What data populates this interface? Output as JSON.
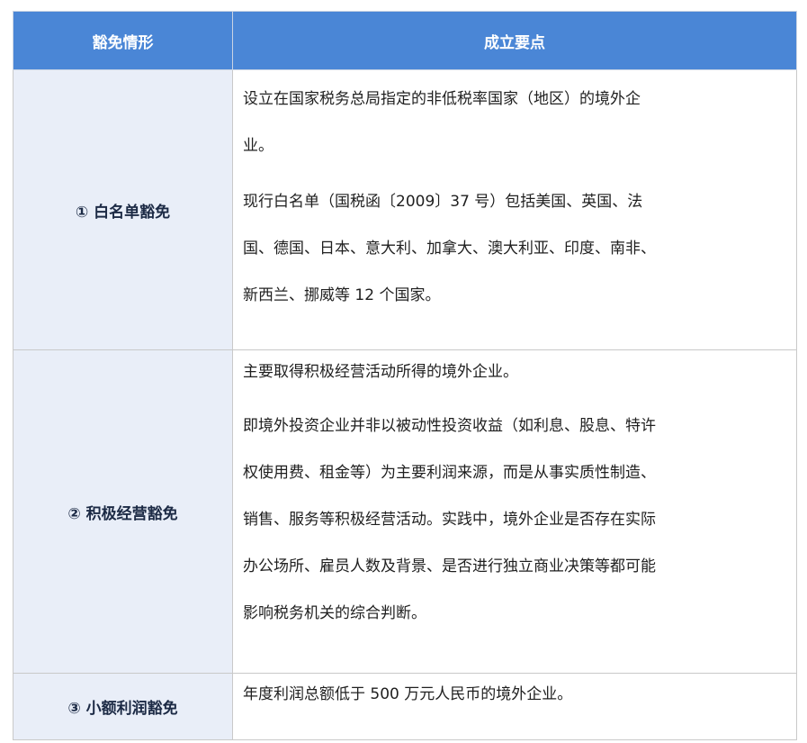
{
  "table": {
    "headers": [
      "豁免情形",
      "成立要点"
    ],
    "rows": [
      {
        "label": "① 白名单豁免",
        "paragraphs": [
          [
            "设立在国家税务总局指定的非低税率国家（地区）的境外企",
            "业。"
          ],
          [
            "现行白名单（国税函〔2009〕37 号）包括美国、英国、法",
            "国、德国、日本、意大利、加拿大、澳大利亚、印度、南非、",
            "新西兰、挪威等 12 个国家。"
          ]
        ]
      },
      {
        "label": "② 积极经营豁免",
        "paragraphs": [
          [
            "主要取得积极经营活动所得的境外企业。"
          ],
          [
            "即境外投资企业并非以被动性投资收益（如利息、股息、特许",
            "权使用费、租金等）为主要利润来源，而是从事实质性制造、",
            "销售、服务等积极经营活动。实践中，境外企业是否存在实际",
            "办公场所、雇员人数及背景、是否进行独立商业决策等都可能",
            "影响税务机关的综合判断。"
          ]
        ]
      },
      {
        "label": "③ 小额利润豁免",
        "paragraphs": [
          [
            "年度利润总额低于 500 万元人民币的境外企业。"
          ]
        ]
      }
    ]
  }
}
